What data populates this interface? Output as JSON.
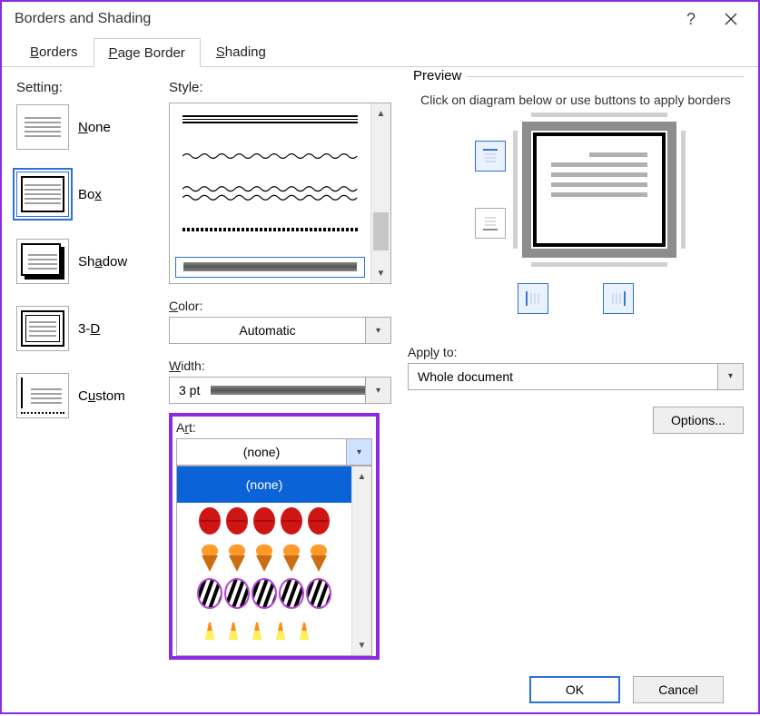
{
  "title": "Borders and Shading",
  "tabs": {
    "borders": "Borders",
    "page_border": "Page Border",
    "shading": "Shading"
  },
  "setting": {
    "label": "Setting:",
    "items": [
      {
        "label": "None",
        "key": "none"
      },
      {
        "label": "Box",
        "key": "box"
      },
      {
        "label": "Shadow",
        "key": "shadow"
      },
      {
        "label": "3-D",
        "key": "3d"
      },
      {
        "label": "Custom",
        "key": "custom"
      }
    ],
    "selected": "box"
  },
  "style": {
    "label": "Style:"
  },
  "color": {
    "label": "Color:",
    "value": "Automatic"
  },
  "width": {
    "label": "Width:",
    "value": "3 pt"
  },
  "art": {
    "label": "Art:",
    "value": "(none)",
    "options": [
      "(none)",
      "art-apples-red",
      "art-ice-cream",
      "art-zebra-stripes",
      "art-candy-corn"
    ]
  },
  "preview": {
    "label": "Preview",
    "hint": "Click on diagram below or use buttons to apply borders"
  },
  "apply_to": {
    "label": "Apply to:",
    "value": "Whole document"
  },
  "buttons": {
    "options": "Options...",
    "ok": "OK",
    "cancel": "Cancel"
  }
}
